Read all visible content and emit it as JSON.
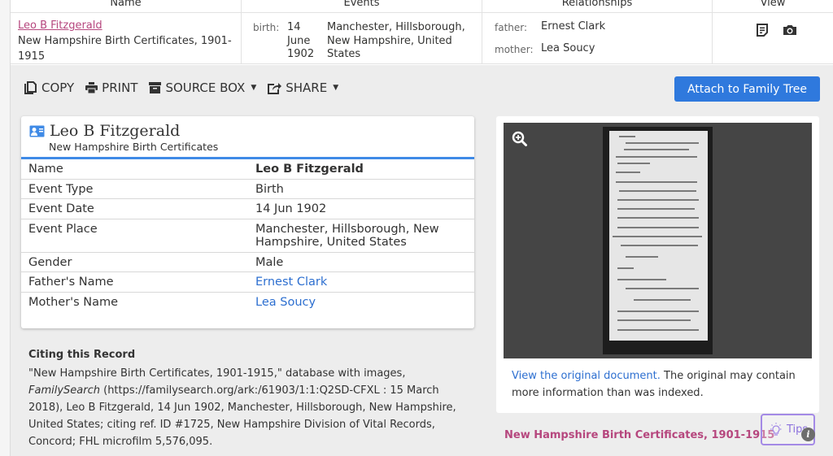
{
  "results_table": {
    "headers": [
      "Name",
      "Events",
      "Relationships",
      "View"
    ],
    "row": {
      "name": "Leo B Fitzgerald",
      "collection": "New Hampshire Birth Certificates, 1901-1915",
      "event": {
        "label": "birth:",
        "date_lines": [
          "14",
          "June",
          "1902"
        ],
        "place": "Manchester, Hillsborough, New Hampshire, United States"
      },
      "relationships": [
        {
          "label": "father:",
          "value": "Ernest Clark"
        },
        {
          "label": "mother:",
          "value": "Lea Soucy"
        }
      ],
      "view_icons": [
        "record-icon",
        "camera-icon"
      ]
    }
  },
  "toolbar": {
    "copy": "COPY",
    "print": "PRINT",
    "source_box": "SOURCE BOX",
    "share": "SHARE",
    "attach": "Attach to Family Tree"
  },
  "record": {
    "title": "Leo B Fitzgerald",
    "subtitle": "New Hampshire Birth Certificates",
    "fields": [
      {
        "key": "Name",
        "value": "Leo B Fitzgerald",
        "style": "bold"
      },
      {
        "key": "Event Type",
        "value": "Birth",
        "style": "plain"
      },
      {
        "key": "Event Date",
        "value": "14 Jun 1902",
        "style": "plain"
      },
      {
        "key": "Event Place",
        "value": "Manchester, Hillsborough, New Hampshire, United States",
        "style": "plain"
      },
      {
        "key": "Gender",
        "value": "Male",
        "style": "plain"
      },
      {
        "key": "Father's Name",
        "value": "Ernest Clark",
        "style": "link"
      },
      {
        "key": "Mother's Name",
        "value": "Lea Soucy",
        "style": "link"
      }
    ]
  },
  "citation": {
    "title": "Citing this Record",
    "part1": "\"New Hampshire Birth Certificates, 1901-1915,\" database with images, ",
    "site": "FamilySearch",
    "part2": " (https://familysearch.org/ark:/61903/1:1:Q2SD-CFXL : 15 March 2018), Leo B Fitzgerald, 14 Jun 1902, Manchester, Hillsborough, New Hampshire, United States; citing ref. ID #1725, New Hampshire Division of Vital Records, Concord; FHL microfilm 5,576,095."
  },
  "image_panel": {
    "link_text": "View the original document.",
    "caption_rest": " The original may contain more information than was indexed."
  },
  "collection_link": "New Hampshire Birth Certificates, 1901-1915",
  "tips": {
    "label": "Tips",
    "info": "i"
  },
  "colors": {
    "accent_blue": "#2f79dd",
    "link_blue": "#2d6fd0",
    "brand_pink": "#b6477e",
    "tips_purple": "#a48ae6"
  }
}
